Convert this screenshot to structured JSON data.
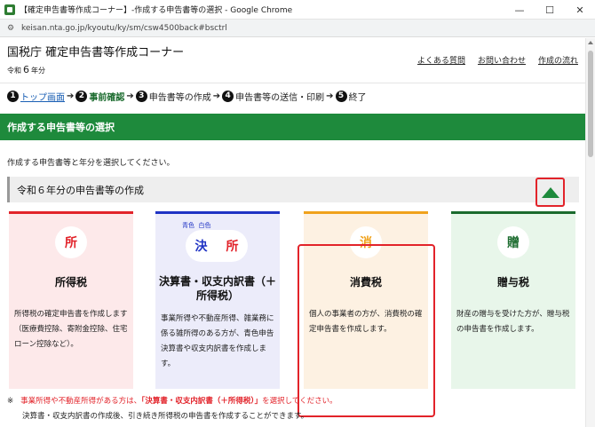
{
  "window": {
    "title": "【確定申告書等作成コーナー】-作成する申告書等の選択 - Google Chrome",
    "minimize": "—",
    "maximize": "☐",
    "close": "✕"
  },
  "address": {
    "url": "keisan.nta.go.jp/kyoutu/ky/sm/csw4500back#bsctrl",
    "icon": "site-info-icon"
  },
  "header": {
    "site_title": "国税庁 確定申告書等作成コーナー",
    "era_prefix": "令和",
    "era_year": "6",
    "era_suffix": "年分",
    "links": [
      "よくある質問",
      "お問い合わせ",
      "作成の流れ"
    ]
  },
  "steps": [
    {
      "num": "1",
      "label": "トップ画面"
    },
    {
      "num": "2",
      "label": "事前確認"
    },
    {
      "num": "3",
      "label": "申告書等の作成"
    },
    {
      "num": "4",
      "label": "申告書等の送信・印刷"
    },
    {
      "num": "5",
      "label": "終了"
    }
  ],
  "step_arrow": "➔",
  "section_title": "作成する申告書等の選択",
  "instruction": "作成する申告書等と年分を選択してください。",
  "year_section": {
    "title": "令和６年分の申告書等の作成"
  },
  "cards": {
    "income": {
      "kanji": "所",
      "title": "所得税",
      "desc": "所得税の確定申告書を作成します（医療費控除、寄附金控除、住宅ローン控除など）。"
    },
    "settlement": {
      "label_blue": "青色",
      "label_white": "白色",
      "kanji_left": "決",
      "kanji_right": "所",
      "title": "決算書・収支内訳書（＋所得税）",
      "desc": "事業所得や不動産所得、雑業務に係る雑所得のある方が、青色申告決算書や収支内訳書を作成します。"
    },
    "consumption": {
      "kanji": "消",
      "title": "消費税",
      "desc": "個人の事業者の方が、消費税の確定申告書を作成します。"
    },
    "gift": {
      "kanji": "贈",
      "title": "贈与税",
      "desc": "財産の贈与を受けた方が、贈与税の申告書を作成します。"
    }
  },
  "note": {
    "mark": "※",
    "text_before": "事業所得や不動産所得がある方は、",
    "emphasis": "「決算書・収支内訳書（＋所得税）」",
    "text_after": "を選択してください。",
    "line2": "決算書・収支内訳書の作成後、引き続き所得税の申告書を作成することができます。"
  },
  "colors": {
    "green": "#1e8a3c",
    "red": "#e2232a",
    "blue": "#1f33c4",
    "orange": "#f0a21c"
  }
}
